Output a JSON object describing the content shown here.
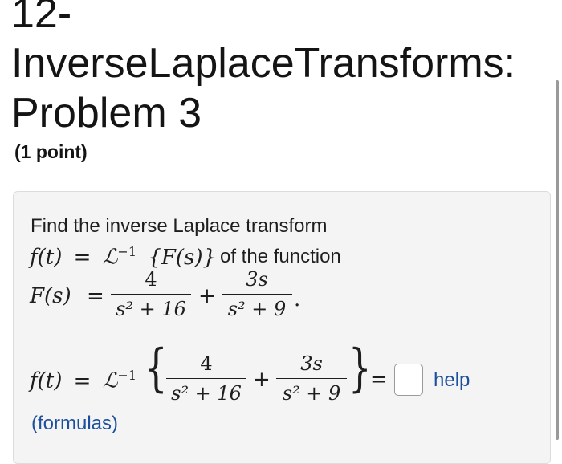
{
  "problem": {
    "title_line1": "12-",
    "title_line2": "InverseLaplaceTransforms:",
    "title_line3": "Problem 3",
    "points": "(1 point)"
  },
  "body": {
    "intro": "Find the inverse Laplace transform",
    "of_the_function": "of the function",
    "f_t": "f(t)",
    "equals": "=",
    "laplace_inverse": "ℒ",
    "inv_exp": "−1",
    "F_s_group": "{F(s)}",
    "F_s": "F(s)",
    "plus": "+",
    "period": ".",
    "frac1_num": "4",
    "frac1_den": "s² + 16",
    "frac2_num": "3s",
    "frac2_den": "s² + 9"
  },
  "answer": {
    "value": "",
    "help_label": "help",
    "formulas_label": "(formulas)"
  }
}
